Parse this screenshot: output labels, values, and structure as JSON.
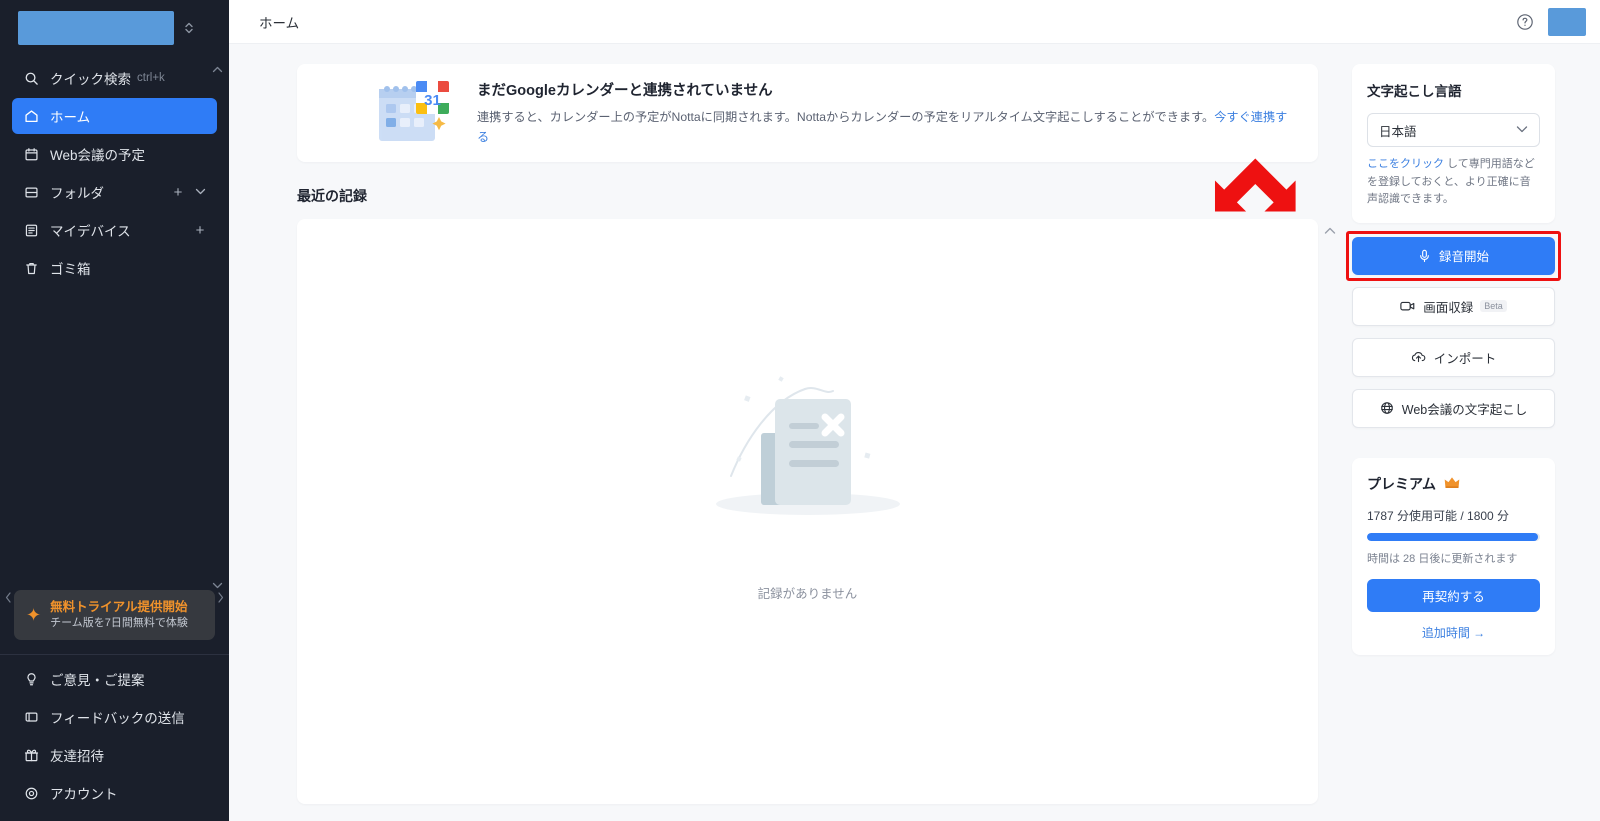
{
  "sidebar": {
    "workspace": {
      "name_redacted": "",
      "caret_icon": "chevron-updown-icon"
    },
    "nav": [
      {
        "label": "クイック検索",
        "kbd": "ctrl+k",
        "icon": "search-icon",
        "active": false
      },
      {
        "label": "ホーム",
        "kbd": "",
        "icon": "home-icon",
        "active": true
      },
      {
        "label": "Web会議の予定",
        "kbd": "",
        "icon": "calendar-icon",
        "active": false
      },
      {
        "label": "フォルダ",
        "kbd": "",
        "icon": "folder-icon",
        "active": false,
        "actions": [
          "plus-icon",
          "chevron-down-icon"
        ]
      },
      {
        "label": "マイデバイス",
        "kbd": "",
        "icon": "device-icon",
        "active": false,
        "actions": [
          "plus-icon"
        ]
      },
      {
        "label": "ゴミ箱",
        "kbd": "",
        "icon": "trash-icon",
        "active": false
      }
    ],
    "trial": {
      "title": "無料トライアル提供開始",
      "subtitle": "チーム版を7日間無料で体験",
      "icon": "sparkle-icon"
    },
    "bottom_nav": [
      {
        "label": "ご意見・ご提案",
        "icon": "lightbulb-icon"
      },
      {
        "label": "フィードバックの送信",
        "icon": "message-icon"
      },
      {
        "label": "友達招待",
        "icon": "gift-icon"
      },
      {
        "label": "アカウント",
        "icon": "gear-icon"
      }
    ]
  },
  "topbar": {
    "title": "ホーム",
    "help_icon": "question-circle-icon",
    "avatar": "avatar-redacted"
  },
  "banner": {
    "title": "まだGoogleカレンダーと連携されていません",
    "desc_part1": "連携すると、カレンダー上の予定がNottaに同期されます。Nottaからカレンダーの予定をリアルタイム文字起こしすることができます。",
    "link": "今すぐ連携する",
    "icon": "google-calendar-icon"
  },
  "records": {
    "section_title": "最近の記録",
    "empty_caption": "記録がありません",
    "empty_icon": "empty-document-icon",
    "scroll_up_icon": "chevron-up-icon"
  },
  "right_panel": {
    "lang_title": "文字起こし言語",
    "lang_value": "日本語",
    "lang_chevron": "chevron-down-icon",
    "note_link": "ここをクリック",
    "note_rest": " して専門用語などを登録しておくと、より正確に音声認識できます。",
    "buttons": [
      {
        "label": "録音開始",
        "icon": "microphone-icon",
        "primary": true,
        "highlighted": true,
        "badge": ""
      },
      {
        "label": "画面収録",
        "icon": "video-camera-icon",
        "primary": false,
        "highlighted": false,
        "badge": "Beta"
      },
      {
        "label": "インポート",
        "icon": "upload-cloud-icon",
        "primary": false,
        "highlighted": false,
        "badge": ""
      },
      {
        "label": "Web会議の文字起こし",
        "icon": "globe-icon",
        "primary": false,
        "highlighted": false,
        "badge": ""
      }
    ]
  },
  "premium": {
    "title": "プレミアム",
    "badge_icon": "crown-icon",
    "usage": "1787 分使用可能 / 1800 分",
    "used_minutes": 1787,
    "total_minutes": 1800,
    "progress_percent": 99,
    "renew": "時間は 28 日後に更新されます",
    "renew_button": "再契約する",
    "extra_link": "追加時間 →"
  },
  "annotation": {
    "arrow_color": "#ee1111",
    "highlight_color": "#ee1111",
    "target": "録音開始"
  },
  "colors": {
    "sidebar_bg": "#1a1f2b",
    "accent": "#2f7cf6",
    "main_bg": "#f7f8fa",
    "trial_orange": "#f0922b",
    "link_blue": "#3b7fe0"
  }
}
